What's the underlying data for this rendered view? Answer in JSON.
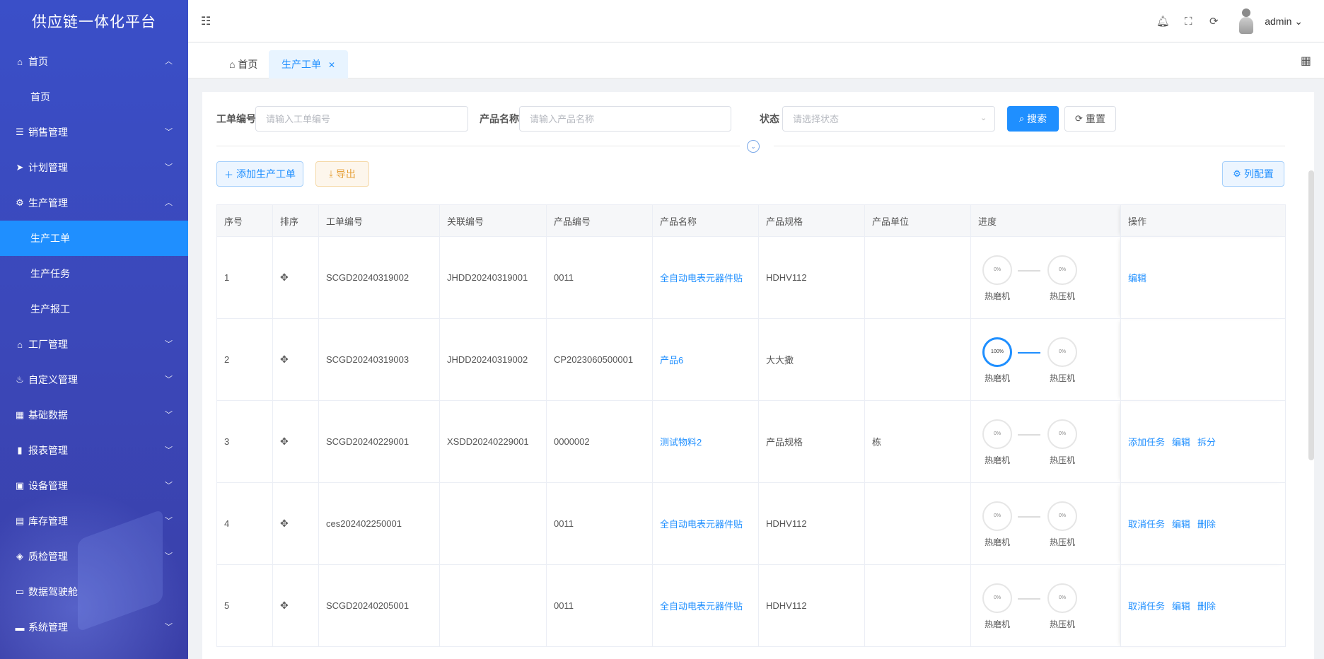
{
  "app": {
    "title": "供应链一体化平台"
  },
  "sidebar": {
    "items": [
      {
        "label": "首页",
        "icon": "home-icon",
        "glyph": "⌂",
        "expanded": true,
        "children": [
          "首页"
        ]
      },
      {
        "label": "销售管理",
        "icon": "list-icon",
        "glyph": "☰",
        "expanded": false
      },
      {
        "label": "计划管理",
        "icon": "send-icon",
        "glyph": "➤",
        "expanded": false
      },
      {
        "label": "生产管理",
        "icon": "wrench-icon",
        "glyph": "⚙",
        "expanded": true,
        "children": [
          "生产工单",
          "生产任务",
          "生产报工"
        ]
      },
      {
        "label": "工厂管理",
        "icon": "bank-icon",
        "glyph": "⌂",
        "expanded": false
      },
      {
        "label": "自定义管理",
        "icon": "flame-icon",
        "glyph": "♨",
        "expanded": false
      },
      {
        "label": "基础数据",
        "icon": "grid-icon",
        "glyph": "▦",
        "expanded": false
      },
      {
        "label": "报表管理",
        "icon": "bar-chart-icon",
        "glyph": "▮",
        "expanded": false
      },
      {
        "label": "设备管理",
        "icon": "device-icon",
        "glyph": "▣",
        "expanded": false
      },
      {
        "label": "库存管理",
        "icon": "warehouse-icon",
        "glyph": "▤",
        "expanded": false
      },
      {
        "label": "质检管理",
        "icon": "shield-icon",
        "glyph": "◈",
        "expanded": false
      },
      {
        "label": "数据驾驶舱",
        "icon": "monitor-icon",
        "glyph": "▭",
        "expanded": false
      },
      {
        "label": "系统管理",
        "icon": "computer-icon",
        "glyph": "▬",
        "expanded": false
      }
    ],
    "active": "生产工单"
  },
  "header": {
    "username": "admin"
  },
  "tabs": [
    {
      "label": "首页"
    },
    {
      "label": "生产工单",
      "active": true
    }
  ],
  "filters": {
    "order_no": {
      "label": "工单编号",
      "placeholder": "请输入工单编号"
    },
    "product_name": {
      "label": "产品名称",
      "placeholder": "请输入产品名称"
    },
    "status": {
      "label": "状态",
      "placeholder": "请选择状态"
    },
    "search_label": "搜索",
    "reset_label": "重置"
  },
  "toolbar": {
    "add_label": "添加生产工单",
    "export_label": "导出",
    "columns_label": "列配置"
  },
  "table": {
    "columns": [
      "序号",
      "排序",
      "工单编号",
      "关联编号",
      "产品编号",
      "产品名称",
      "产品规格",
      "产品单位",
      "进度",
      "操作"
    ],
    "rows": [
      {
        "idx": "1",
        "order_no": "SCGD20240319002",
        "rel_no": "JHDD20240319001",
        "product_no": "0011",
        "product_name": "全自动电表元器件贴",
        "spec": "HDHV112",
        "unit": "",
        "progress": [
          {
            "name": "热磨机",
            "text": "0%",
            "value": 0
          },
          {
            "name": "热压机",
            "text": "0%",
            "value": 0
          }
        ],
        "actions": [
          "编辑"
        ]
      },
      {
        "idx": "2",
        "order_no": "SCGD20240319003",
        "rel_no": "JHDD20240319002",
        "product_no": "CP2023060500001",
        "product_name": "产品6",
        "spec": "大大撒",
        "unit": "",
        "progress": [
          {
            "name": "热磨机",
            "text": "100%",
            "value": 100
          },
          {
            "name": "热压机",
            "text": "0%",
            "value": 0
          }
        ],
        "actions": []
      },
      {
        "idx": "3",
        "order_no": "SCGD20240229001",
        "rel_no": "XSDD20240229001",
        "product_no": "0000002",
        "product_name": "测试物料2",
        "spec": "产品规格",
        "unit": "栋",
        "progress": [
          {
            "name": "热磨机",
            "text": "0%",
            "value": 0
          },
          {
            "name": "热压机",
            "text": "0%",
            "value": 0
          }
        ],
        "actions": [
          "添加任务",
          "编辑",
          "拆分"
        ]
      },
      {
        "idx": "4",
        "order_no": "ces202402250001",
        "rel_no": "",
        "product_no": "0011",
        "product_name": "全自动电表元器件贴",
        "spec": "HDHV112",
        "unit": "",
        "progress": [
          {
            "name": "热磨机",
            "text": "0%",
            "value": 0
          },
          {
            "name": "热压机",
            "text": "0%",
            "value": 0
          }
        ],
        "actions": [
          "取消任务",
          "编辑",
          "删除"
        ]
      },
      {
        "idx": "5",
        "order_no": "SCGD20240205001",
        "rel_no": "",
        "product_no": "0011",
        "product_name": "全自动电表元器件贴",
        "spec": "HDHV112",
        "unit": "",
        "progress": [
          {
            "name": "热磨机",
            "text": "0%",
            "value": 0
          },
          {
            "name": "热压机",
            "text": "0%",
            "value": 0
          }
        ],
        "actions": [
          "取消任务",
          "编辑",
          "删除"
        ]
      }
    ]
  },
  "colors": {
    "primary": "#1f8fff",
    "sidebar": "#3a4fc8",
    "warning": "#e6a23c"
  }
}
